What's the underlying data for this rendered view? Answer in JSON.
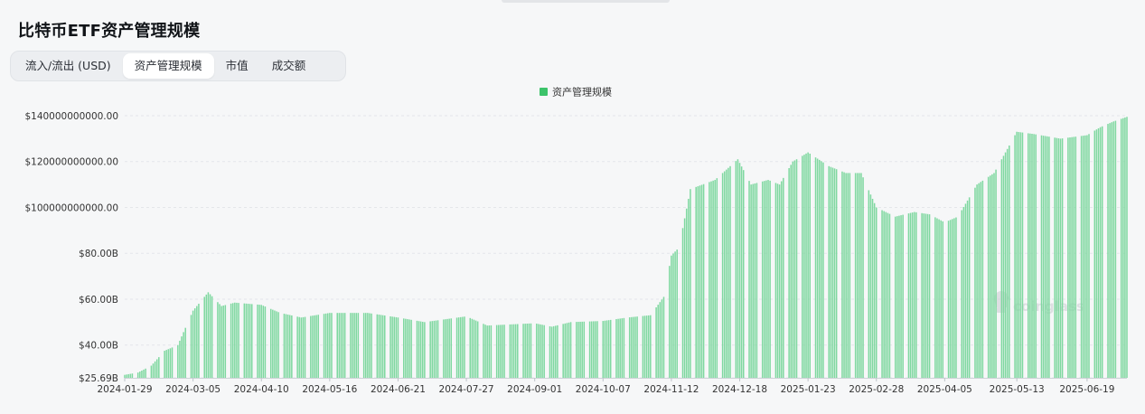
{
  "header": {
    "title": "比特币ETF资产管理规模"
  },
  "tabs": [
    {
      "label": "流入/流出 (USD)",
      "active": false
    },
    {
      "label": "资产管理规模",
      "active": true
    },
    {
      "label": "市值",
      "active": false
    },
    {
      "label": "成交额",
      "active": false
    }
  ],
  "watermark": {
    "text": "coinglass",
    "icon": "coinglass-logo-icon"
  },
  "colors": {
    "bar": "#7fd8a0",
    "bar_stroke": "#5fc985",
    "legend": "#3cc36a",
    "grid": "#e4e6ea",
    "axis_text": "#333333"
  },
  "chart_data": {
    "type": "bar",
    "legend": [
      "资产管理规模"
    ],
    "legend_position": "top-center",
    "grid": true,
    "ylim": [
      25.69,
      140
    ],
    "y_ticks": [
      {
        "value": 25.69,
        "label": "$25.69B"
      },
      {
        "value": 40,
        "label": "$40.00B"
      },
      {
        "value": 60,
        "label": "$60.00B"
      },
      {
        "value": 80,
        "label": "$80.00B"
      },
      {
        "value": 100,
        "label": "$100000000000.00"
      },
      {
        "value": 120,
        "label": "$120000000000.00"
      },
      {
        "value": 140,
        "label": "$140000000000.00"
      }
    ],
    "x_ticks": [
      "2024-01-29",
      "2024-03-05",
      "2024-04-10",
      "2024-05-16",
      "2024-06-21",
      "2024-07-27",
      "2024-09-01",
      "2024-10-07",
      "2024-11-12",
      "2024-12-18",
      "2025-01-23",
      "2025-02-28",
      "2025-04-05",
      "2025-05-13",
      "2025-06-19"
    ],
    "series": [
      {
        "name": "资产管理规模",
        "x_start": "2024-01-29",
        "x_end": "2025-07-10",
        "keypoints": [
          [
            "2024-01-29",
            27.0
          ],
          [
            "2024-02-05",
            28.0
          ],
          [
            "2024-02-12",
            31.0
          ],
          [
            "2024-02-19",
            37.5
          ],
          [
            "2024-02-26",
            40.0
          ],
          [
            "2024-03-05",
            55.0
          ],
          [
            "2024-03-13",
            63.0
          ],
          [
            "2024-03-20",
            57.0
          ],
          [
            "2024-03-27",
            58.5
          ],
          [
            "2024-04-10",
            57.5
          ],
          [
            "2024-04-20",
            54.0
          ],
          [
            "2024-05-01",
            52.0
          ],
          [
            "2024-05-16",
            54.0
          ],
          [
            "2024-06-05",
            54.0
          ],
          [
            "2024-06-21",
            52.0
          ],
          [
            "2024-07-05",
            50.0
          ],
          [
            "2024-07-27",
            52.5
          ],
          [
            "2024-08-07",
            48.5
          ],
          [
            "2024-09-01",
            49.5
          ],
          [
            "2024-09-10",
            48.0
          ],
          [
            "2024-09-20",
            50.0
          ],
          [
            "2024-10-07",
            50.5
          ],
          [
            "2024-10-20",
            52.0
          ],
          [
            "2024-11-01",
            53.0
          ],
          [
            "2024-11-08",
            61.0
          ],
          [
            "2024-11-12",
            79.0
          ],
          [
            "2024-11-16",
            82.5
          ],
          [
            "2024-11-22",
            108.0
          ],
          [
            "2024-12-05",
            112.0
          ],
          [
            "2024-12-17",
            121.0
          ],
          [
            "2024-12-24",
            110.0
          ],
          [
            "2025-01-02",
            112.0
          ],
          [
            "2025-01-08",
            110.0
          ],
          [
            "2025-01-15",
            120.0
          ],
          [
            "2025-01-23",
            124.0
          ],
          [
            "2025-02-03",
            118.0
          ],
          [
            "2025-02-12",
            115.0
          ],
          [
            "2025-02-20",
            115.0
          ],
          [
            "2025-02-28",
            100.0
          ],
          [
            "2025-03-10",
            96.0
          ],
          [
            "2025-03-20",
            98.0
          ],
          [
            "2025-03-28",
            97.0
          ],
          [
            "2025-04-05",
            93.5
          ],
          [
            "2025-04-12",
            96.0
          ],
          [
            "2025-04-22",
            110.0
          ],
          [
            "2025-05-01",
            115.0
          ],
          [
            "2025-05-13",
            133.0
          ],
          [
            "2025-05-22",
            132.0
          ],
          [
            "2025-06-05",
            130.0
          ],
          [
            "2025-06-19",
            131.5
          ],
          [
            "2025-06-26",
            135.0
          ],
          [
            "2025-07-03",
            137.5
          ],
          [
            "2025-07-10",
            139.5
          ]
        ]
      }
    ]
  }
}
